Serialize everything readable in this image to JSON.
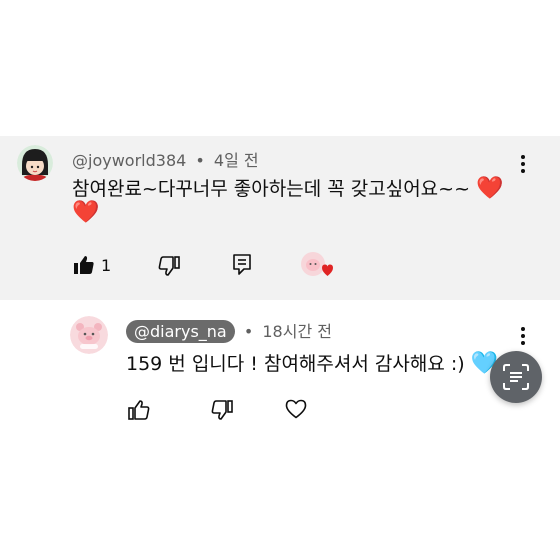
{
  "comment": {
    "author": "@joyworld384",
    "separator": "•",
    "time": "4일 전",
    "text": "참여완료~다꾸너무 좋아하는데 꼭 갖고싶어요~~",
    "emoji_inline": "❤️",
    "emoji_wrap": "❤️",
    "like_count": "1",
    "icons": [
      "thumb-up-filled-icon",
      "thumb-down-icon",
      "reply-icon",
      "creator-heart-icon",
      "more-vert-icon"
    ]
  },
  "reply": {
    "author": "@diarys_na",
    "separator": "•",
    "time": "18시간 전",
    "text": "159 번 입니다 ! 참여해주셔서 감사해요 :)",
    "emoji_inline": "🩵",
    "icons": [
      "thumb-up-icon",
      "thumb-down-icon",
      "heart-outline-icon",
      "more-vert-icon",
      "lens-icon"
    ]
  },
  "colors": {
    "comment_bg": "#f2f2f2",
    "heart_red": "#e02424",
    "chip_bg": "#6b6b6b",
    "light_blue_heart": "#7cc8f0"
  }
}
